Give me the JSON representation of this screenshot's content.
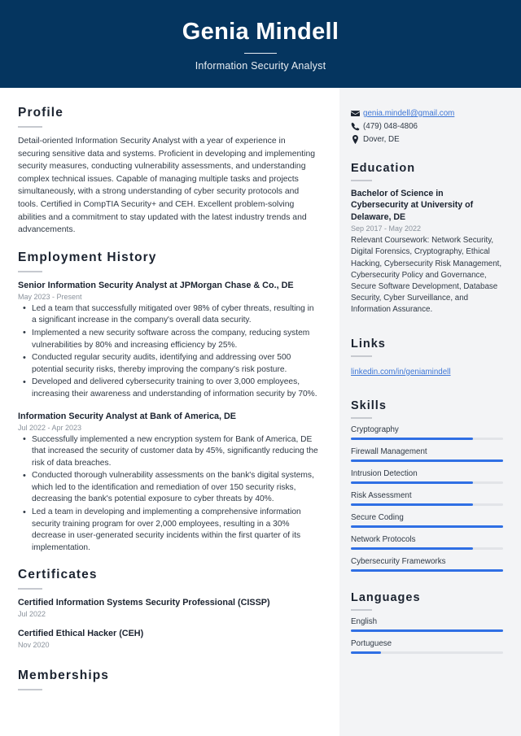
{
  "header": {
    "name": "Genia Mindell",
    "job_title": "Information Security Analyst",
    "background_color": "#05355f"
  },
  "theme": {
    "accent_color": "#2f6fe4",
    "link_color": "#3d76d6",
    "sidebar_background": "#f3f4f6",
    "heading_color": "#1b2330",
    "muted_text_color": "#8a929c"
  },
  "main": {
    "profile": {
      "heading": "Profile",
      "text": "Detail-oriented Information Security Analyst with a year of experience in securing sensitive data and systems. Proficient in developing and implementing security measures, conducting vulnerability assessments, and understanding complex technical issues. Capable of managing multiple tasks and projects simultaneously, with a strong understanding of cyber security protocols and tools. Certified in CompTIA Security+ and CEH. Excellent problem-solving abilities and a commitment to stay updated with the latest industry trends and advancements."
    },
    "employment": {
      "heading": "Employment History",
      "jobs": [
        {
          "title": "Senior Information Security Analyst at JPMorgan Chase & Co., DE",
          "date": "May 2023 - Present",
          "bullets": [
            "Led a team that successfully mitigated over 98% of cyber threats, resulting in a significant increase in the company's overall data security.",
            "Implemented a new security software across the company, reducing system vulnerabilities by 80% and increasing efficiency by 25%.",
            "Conducted regular security audits, identifying and addressing over 500 potential security risks, thereby improving the company's risk posture.",
            "Developed and delivered cybersecurity training to over 3,000 employees, increasing their awareness and understanding of information security by 70%."
          ]
        },
        {
          "title": "Information Security Analyst at Bank of America, DE",
          "date": "Jul 2022 - Apr 2023",
          "bullets": [
            "Successfully implemented a new encryption system for Bank of America, DE that increased the security of customer data by 45%, significantly reducing the risk of data breaches.",
            "Conducted thorough vulnerability assessments on the bank's digital systems, which led to the identification and remediation of over 150 security risks, decreasing the bank's potential exposure to cyber threats by 40%.",
            "Led a team in developing and implementing a comprehensive information security training program for over 2,000 employees, resulting in a 30% decrease in user-generated security incidents within the first quarter of its implementation."
          ]
        }
      ]
    },
    "certificates": {
      "heading": "Certificates",
      "items": [
        {
          "name": "Certified Information Systems Security Professional (CISSP)",
          "date": "Jul 2022"
        },
        {
          "name": "Certified Ethical Hacker (CEH)",
          "date": "Nov 2020"
        }
      ]
    },
    "memberships": {
      "heading": "Memberships"
    }
  },
  "sidebar": {
    "contact": [
      {
        "icon": "envelope-icon",
        "value": "genia.mindell@gmail.com",
        "is_link": true
      },
      {
        "icon": "phone-icon",
        "value": "(479) 048-4806",
        "is_link": false
      },
      {
        "icon": "location-pin-icon",
        "value": "Dover, DE",
        "is_link": false
      }
    ],
    "education": {
      "heading": "Education",
      "degree": "Bachelor of Science in Cybersecurity at University of Delaware, DE",
      "date": "Sep 2017 - May 2022",
      "description": "Relevant Coursework: Network Security, Digital Forensics, Cryptography, Ethical Hacking, Cybersecurity Risk Management, Cybersecurity Policy and Governance, Secure Software Development, Database Security, Cyber Surveillance, and Information Assurance."
    },
    "links": {
      "heading": "Links",
      "items": [
        {
          "label": "linkedin.com/in/geniamindell"
        }
      ]
    },
    "skills": {
      "heading": "Skills",
      "items": [
        {
          "label": "Cryptography",
          "level": 80
        },
        {
          "label": "Firewall Management",
          "level": 100
        },
        {
          "label": "Intrusion Detection",
          "level": 80
        },
        {
          "label": "Risk Assessment",
          "level": 80
        },
        {
          "label": "Secure Coding",
          "level": 100
        },
        {
          "label": "Network Protocols",
          "level": 80
        },
        {
          "label": "Cybersecurity Frameworks",
          "level": 100
        }
      ]
    },
    "languages": {
      "heading": "Languages",
      "items": [
        {
          "label": "English",
          "level": 100
        },
        {
          "label": "Portuguese",
          "level": 20
        }
      ]
    }
  }
}
